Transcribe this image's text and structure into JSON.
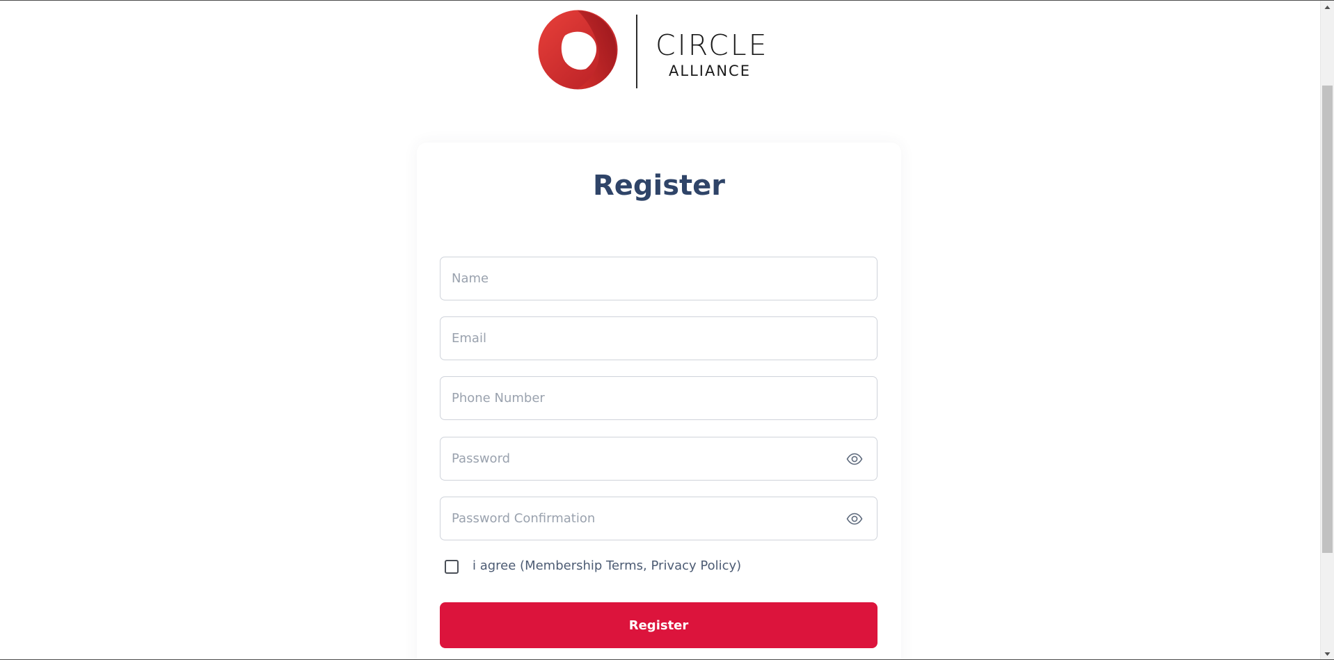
{
  "brand": {
    "name_main": "CIRCLE",
    "name_sub": "ALLIANCE",
    "primary_color": "#dc143c",
    "logo_red": "#d42a2a"
  },
  "form": {
    "title": "Register",
    "fields": {
      "name": {
        "placeholder": "Name",
        "value": ""
      },
      "email": {
        "placeholder": "Email",
        "value": ""
      },
      "phone": {
        "placeholder": "Phone Number",
        "value": ""
      },
      "password": {
        "placeholder": "Password",
        "value": ""
      },
      "password_confirmation": {
        "placeholder": "Password Confirmation",
        "value": ""
      }
    },
    "agree_label": "i agree (Membership Terms, Privacy Policy)",
    "agree_checked": false,
    "submit_label": "Register"
  },
  "icons": {
    "password_toggle": "eye-icon",
    "password_confirmation_toggle": "eye-icon",
    "scroll_up": "chevron-up-icon",
    "scroll_down": "chevron-down-icon"
  }
}
